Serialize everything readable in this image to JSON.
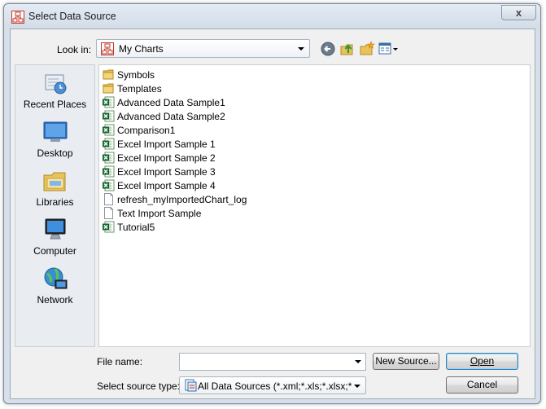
{
  "window": {
    "title": "Select Data Source",
    "close_glyph": "x"
  },
  "lookin": {
    "label": "Look in:",
    "value": "My Charts"
  },
  "places": [
    {
      "label": "Recent Places",
      "icon": "recent-places-icon"
    },
    {
      "label": "Desktop",
      "icon": "desktop-icon"
    },
    {
      "label": "Libraries",
      "icon": "libraries-icon"
    },
    {
      "label": "Computer",
      "icon": "computer-icon"
    },
    {
      "label": "Network",
      "icon": "network-icon"
    }
  ],
  "files": [
    {
      "name": "Symbols",
      "type": "folder"
    },
    {
      "name": "Templates",
      "type": "folder"
    },
    {
      "name": "Advanced Data Sample1",
      "type": "excel"
    },
    {
      "name": "Advanced Data Sample2",
      "type": "excel"
    },
    {
      "name": "Comparison1",
      "type": "excel"
    },
    {
      "name": "Excel Import Sample 1",
      "type": "excel"
    },
    {
      "name": "Excel Import Sample 2",
      "type": "excel"
    },
    {
      "name": "Excel Import Sample 3",
      "type": "excel"
    },
    {
      "name": "Excel Import Sample 4",
      "type": "excel"
    },
    {
      "name": "refresh_myImportedChart_log",
      "type": "text"
    },
    {
      "name": "Text Import Sample",
      "type": "text"
    },
    {
      "name": "Tutorial5",
      "type": "excel"
    }
  ],
  "footer": {
    "filename_label": "File name:",
    "filename_value": "",
    "source_type_label": "Select source type:",
    "source_type_value": "All Data Sources (*.xml;*.xls;*.xlsx;*.c",
    "new_source_label": "New Source...",
    "open_label": "Open",
    "cancel_label": "Cancel"
  },
  "colors": {
    "excel_green": "#1f7a3a",
    "folder_yellow": "#e8c25a",
    "accent_blue": "#3c7fb1"
  }
}
